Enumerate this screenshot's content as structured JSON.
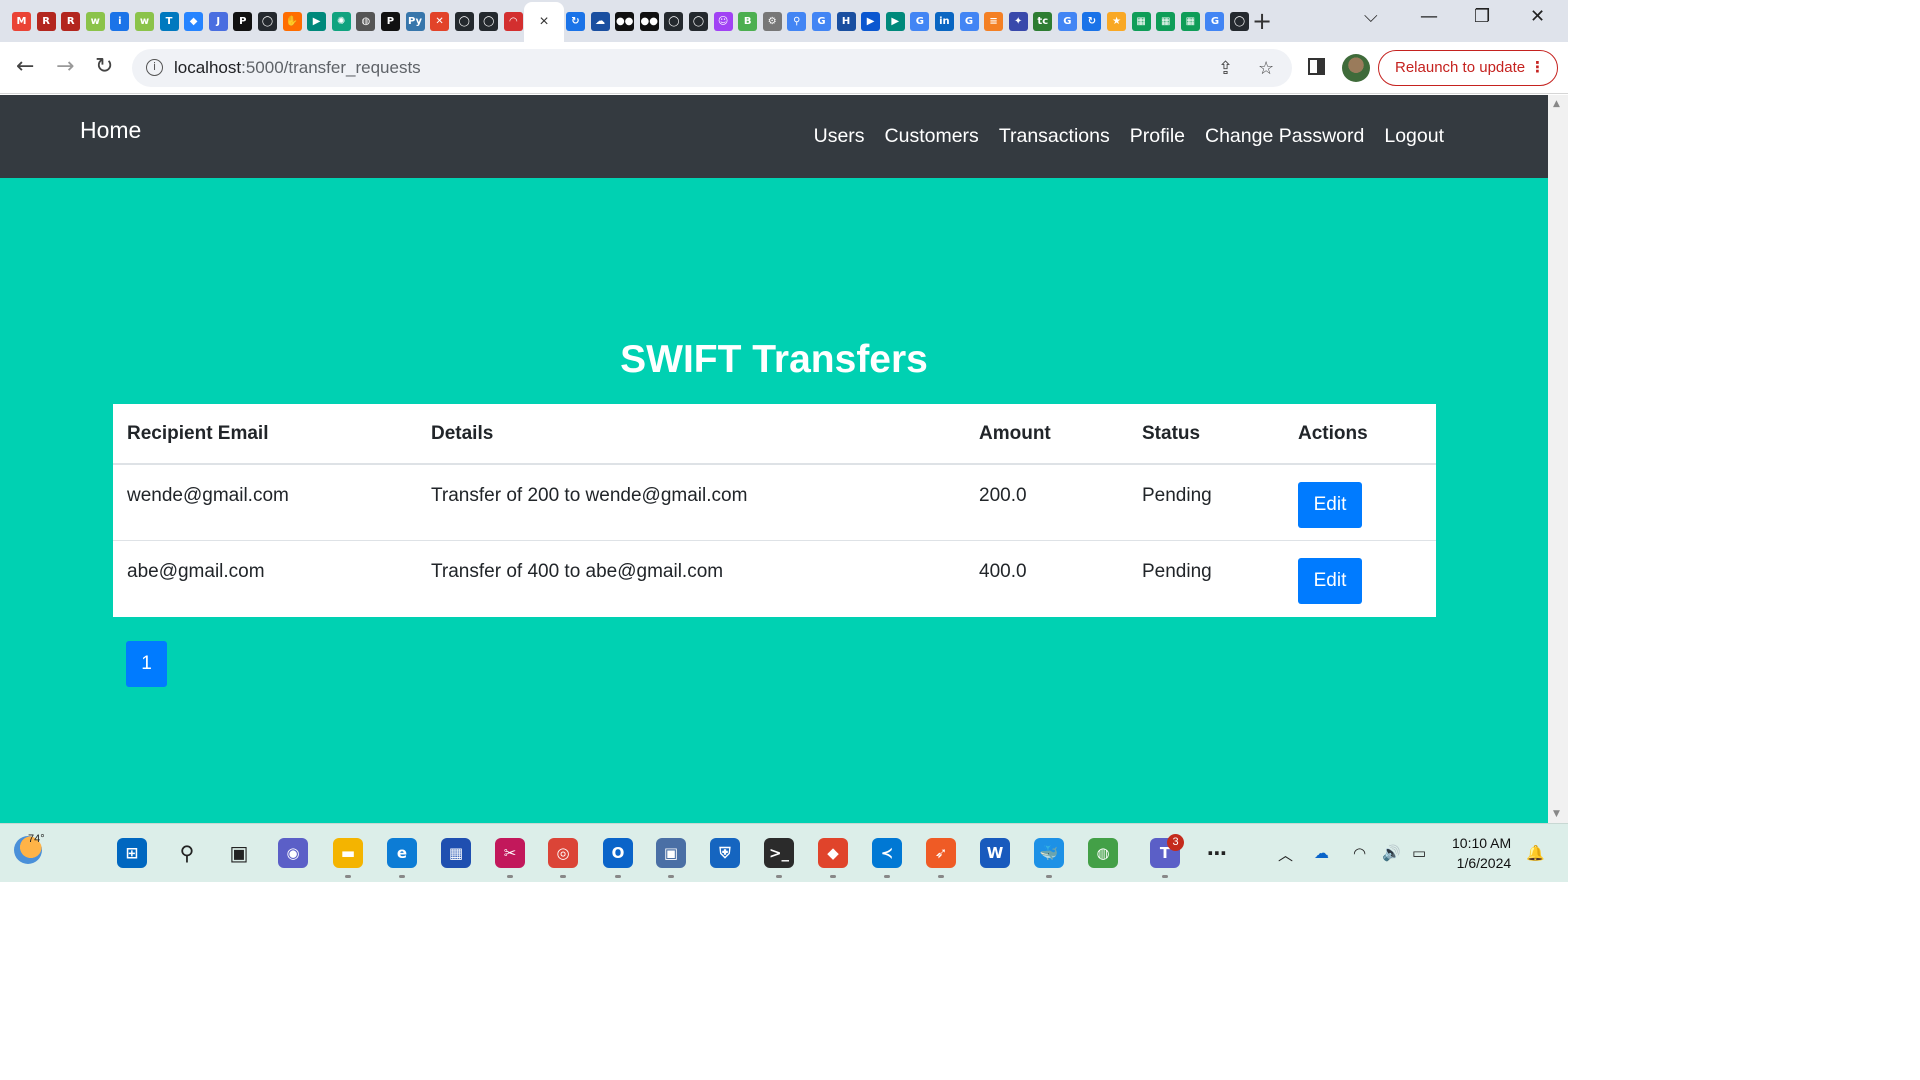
{
  "browser": {
    "url_host": "localhost",
    "url_path": ":5000/transfer_requests",
    "relaunch_label": "Relaunch to update",
    "active_tab_close": "×",
    "tab_favicons": [
      {
        "name": "gmail-favicon",
        "glyph": "M",
        "color": "#ea4335"
      },
      {
        "name": "bookmark-red-favicon",
        "glyph": "R",
        "color": "#b3261e"
      },
      {
        "name": "bookmark-red-favicon",
        "glyph": "R",
        "color": "#b3261e"
      },
      {
        "name": "leetcode-favicon",
        "glyph": "w",
        "color": "#8bc34a"
      },
      {
        "name": "info-favicon",
        "glyph": "i",
        "color": "#1a73e8"
      },
      {
        "name": "leetcode-favicon",
        "glyph": "w",
        "color": "#8bc34a"
      },
      {
        "name": "trello-favicon",
        "glyph": "T",
        "color": "#0079bf"
      },
      {
        "name": "jira-favicon",
        "glyph": "◆",
        "color": "#2684ff"
      },
      {
        "name": "j2c-favicon",
        "glyph": "J",
        "color": "#4a6ee0"
      },
      {
        "name": "p-favicon",
        "glyph": "P",
        "color": "#111111"
      },
      {
        "name": "github-favicon",
        "glyph": "◯",
        "color": "#24292e"
      },
      {
        "name": "hand-favicon",
        "glyph": "✋",
        "color": "#ff6d00"
      },
      {
        "name": "meet-favicon",
        "glyph": "▶",
        "color": "#00897b"
      },
      {
        "name": "chatgpt-favicon",
        "glyph": "✺",
        "color": "#10a37f"
      },
      {
        "name": "globe-favicon",
        "glyph": "◍",
        "color": "#555555"
      },
      {
        "name": "p-favicon",
        "glyph": "P",
        "color": "#111111"
      },
      {
        "name": "python-favicon",
        "glyph": "Py",
        "color": "#3776ab"
      },
      {
        "name": "gitlab-favicon",
        "glyph": "✕",
        "color": "#e24329"
      },
      {
        "name": "github-favicon",
        "glyph": "◯",
        "color": "#24292e"
      },
      {
        "name": "github-favicon",
        "glyph": "◯",
        "color": "#24292e"
      },
      {
        "name": "speed-favicon",
        "glyph": "◠",
        "color": "#d32f2f"
      }
    ],
    "tab_favicons_right": [
      {
        "name": "sync-favicon",
        "glyph": "↻",
        "color": "#1a73e8"
      },
      {
        "name": "cloud-favicon",
        "glyph": "☁",
        "color": "#1a4fa0"
      },
      {
        "name": "medium-favicon",
        "glyph": "●●",
        "color": "#111111"
      },
      {
        "name": "medium-favicon",
        "glyph": "●●",
        "color": "#111111"
      },
      {
        "name": "github-favicon",
        "glyph": "◯",
        "color": "#24292e"
      },
      {
        "name": "github-favicon",
        "glyph": "◯",
        "color": "#24292e"
      },
      {
        "name": "bot-favicon",
        "glyph": "☺",
        "color": "#a142f4"
      },
      {
        "name": "b64-favicon",
        "glyph": "B",
        "color": "#4caf50"
      },
      {
        "name": "tool-favicon",
        "glyph": "⚙",
        "color": "#777777"
      },
      {
        "name": "pin-favicon",
        "glyph": "⚲",
        "color": "#4285f4"
      },
      {
        "name": "google-favicon",
        "glyph": "G",
        "color": "#4285f4"
      },
      {
        "name": "hst-favicon",
        "glyph": "H",
        "color": "#1a4fa0"
      },
      {
        "name": "video-favicon",
        "glyph": "▶",
        "color": "#0b57d0"
      },
      {
        "name": "meet-favicon",
        "glyph": "▶",
        "color": "#00897b"
      },
      {
        "name": "google-favicon",
        "glyph": "G",
        "color": "#4285f4"
      },
      {
        "name": "linkedin-favicon",
        "glyph": "in",
        "color": "#0a66c2"
      },
      {
        "name": "google-favicon",
        "glyph": "G",
        "color": "#4285f4"
      },
      {
        "name": "stack-favicon",
        "glyph": "≡",
        "color": "#f48024"
      },
      {
        "name": "puzzle-favicon",
        "glyph": "✦",
        "color": "#3949ab"
      },
      {
        "name": "tc-favicon",
        "glyph": "tc",
        "color": "#2e7d32"
      },
      {
        "name": "google-favicon",
        "glyph": "G",
        "color": "#4285f4"
      },
      {
        "name": "sync-favicon",
        "glyph": "↻",
        "color": "#1a73e8"
      },
      {
        "name": "star-favicon",
        "glyph": "★",
        "color": "#f9a825"
      },
      {
        "name": "sheets-favicon",
        "glyph": "▦",
        "color": "#0f9d58"
      },
      {
        "name": "sheets-favicon",
        "glyph": "▦",
        "color": "#0f9d58"
      },
      {
        "name": "sheets-favicon",
        "glyph": "▦",
        "color": "#0f9d58"
      },
      {
        "name": "google-favicon",
        "glyph": "G",
        "color": "#4285f4"
      },
      {
        "name": "github-favicon",
        "glyph": "◯",
        "color": "#24292e"
      }
    ]
  },
  "navbar": {
    "brand": "Home",
    "links": [
      "Users",
      "Customers",
      "Transactions",
      "Profile",
      "Change Password",
      "Logout"
    ]
  },
  "page": {
    "title": "SWIFT Transfers",
    "background": "#00d1b2"
  },
  "table": {
    "headers": [
      "Recipient Email",
      "Details",
      "Amount",
      "Status",
      "Actions"
    ],
    "rows": [
      {
        "email": "wende@gmail.com",
        "details": "Transfer of 200 to wende@gmail.com",
        "amount": "200.0",
        "status": "Pending",
        "action": "Edit"
      },
      {
        "email": "abe@gmail.com",
        "details": "Transfer of 400 to abe@gmail.com",
        "amount": "400.0",
        "status": "Pending",
        "action": "Edit"
      }
    ]
  },
  "pagination": {
    "current_page": "1"
  },
  "taskbar": {
    "weather_temp": "74°",
    "time": "10:10 AM",
    "date": "1/6/2024",
    "teams_badge": "3",
    "apps": [
      {
        "name": "start-icon",
        "glyph": "⊞",
        "color": "#0067c0"
      },
      {
        "name": "search-icon",
        "glyph": "⚲",
        "color": "#222222"
      },
      {
        "name": "task-view-icon",
        "glyph": "▣",
        "color": "#222222"
      },
      {
        "name": "chat-icon",
        "glyph": "◉",
        "color": "#5b5fc7"
      },
      {
        "name": "file-explorer-icon",
        "glyph": "▬",
        "color": "#f4b400"
      },
      {
        "name": "edge-icon",
        "glyph": "e",
        "color": "#0c7cd5"
      },
      {
        "name": "store-icon",
        "glyph": "▦",
        "color": "#1f4fb0"
      },
      {
        "name": "snipping-icon",
        "glyph": "✂",
        "color": "#c2185b"
      },
      {
        "name": "chrome-icon",
        "glyph": "◎",
        "color": "#db4437"
      },
      {
        "name": "outlook-icon",
        "glyph": "O",
        "color": "#0a64c9"
      },
      {
        "name": "remote-desktop-icon",
        "glyph": "▣",
        "color": "#4a6fa5"
      },
      {
        "name": "defender-icon",
        "glyph": "⛨",
        "color": "#1565c0"
      },
      {
        "name": "terminal-icon",
        "glyph": ">_",
        "color": "#2b2b2b"
      },
      {
        "name": "git-icon",
        "glyph": "◆",
        "color": "#e0442b"
      },
      {
        "name": "vscode-icon",
        "glyph": "≺",
        "color": "#0078d4"
      },
      {
        "name": "postman-icon",
        "glyph": "➶",
        "color": "#ef5b25"
      },
      {
        "name": "word-icon",
        "glyph": "W",
        "color": "#185abd"
      },
      {
        "name": "docker-icon",
        "glyph": "🐳",
        "color": "#1d91e6"
      },
      {
        "name": "tool-icon",
        "glyph": "◍",
        "color": "#43a047"
      },
      {
        "name": "teams-icon",
        "glyph": "T",
        "color": "#5b5fc7"
      },
      {
        "name": "more-icon",
        "glyph": "⋯",
        "color": "#222222"
      }
    ]
  }
}
